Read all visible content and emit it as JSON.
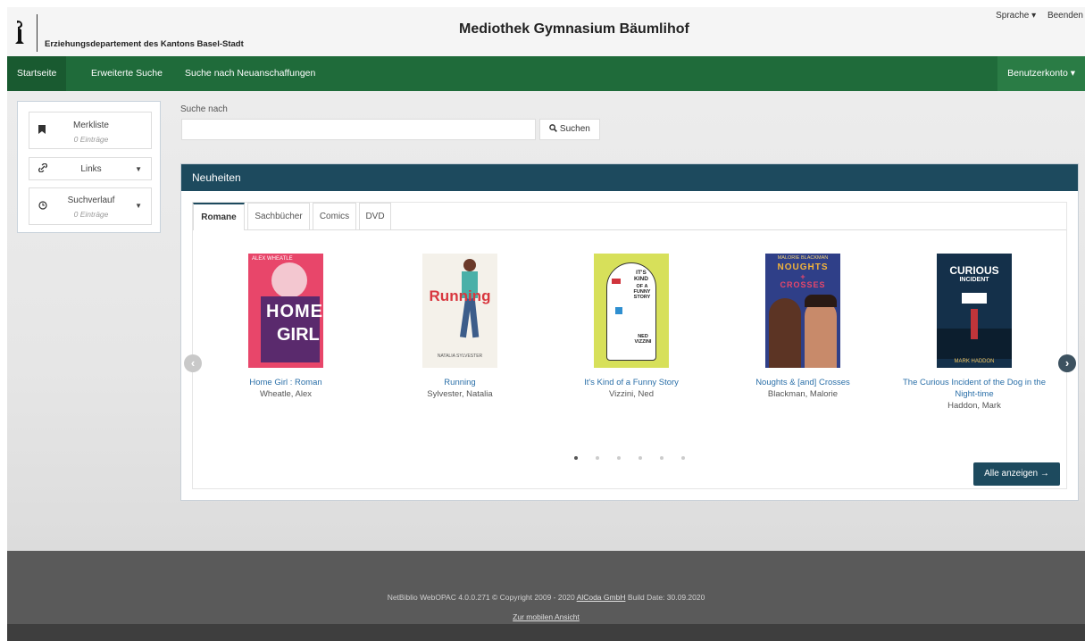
{
  "header": {
    "org_name": "Erziehungsdepartement des Kantons Basel-Stadt",
    "site_title": "Mediothek Gymnasium Bäumlihof",
    "language_link": "Sprache ▾",
    "exit_link": "Beenden"
  },
  "nav": {
    "home": "Startseite",
    "advanced_search": "Erweiterte Suche",
    "new_acquisitions": "Suche nach Neuanschaffungen",
    "account": "Benutzerkonto ▾"
  },
  "sidebar": {
    "watchlist_label": "Merkliste",
    "watchlist_count": "0 Einträge",
    "links_label": "Links",
    "history_label": "Suchverlauf",
    "history_count": "0 Einträge"
  },
  "search": {
    "label": "Suche nach",
    "value": "",
    "button": "Suchen"
  },
  "panel": {
    "title": "Neuheiten",
    "tabs": [
      "Romane",
      "Sachbücher",
      "Comics",
      "DVD"
    ],
    "books": [
      {
        "title": "Home Girl : Roman",
        "title2": "",
        "author": "Wheatle, Alex"
      },
      {
        "title": "Running",
        "title2": "",
        "author": "Sylvester, Natalia"
      },
      {
        "title": "It's Kind of a Funny Story",
        "title2": "",
        "author": "Vizzini, Ned"
      },
      {
        "title": "Noughts & [and] Crosses",
        "title2": "",
        "author": "Blackman, Malorie"
      },
      {
        "title": "The Curious Incident of the Dog in the",
        "title2": "Night-time",
        "author": "Haddon, Mark"
      }
    ],
    "covers": [
      {
        "line1": "HOME",
        "line2": "GIRL",
        "small": "ALEX WHEATLE",
        "color": "#e8466a"
      },
      {
        "line1": "Running",
        "line2": "",
        "small": "NATALIA SYLVESTER",
        "color": "#f4f1ea"
      },
      {
        "line1": "IT'S KIND",
        "line2": "OF A FUNNY STORY",
        "small": "NED VIZZINI",
        "color": "#d7e05a"
      },
      {
        "line1": "NOUGHTS",
        "line2": "CROSSES",
        "small": "MALORIE BLACKMAN",
        "color": "#2f3f88"
      },
      {
        "line1": "CURIOUS",
        "line2": "INCIDENT",
        "small": "MARK HADDON",
        "color": "#14304a"
      }
    ],
    "show_all": "Alle anzeigen →",
    "page_count": 6,
    "active_page": 1
  },
  "footer": {
    "text_before": "NetBiblio WebOPAC 4.0.0.271 © Copyright 2009 - 2020 ",
    "company_link": "AlCoda GmbH",
    "text_after": " Build Date: 30.09.2020",
    "mobile_link": "Zur mobilen Ansicht"
  },
  "colors": {
    "nav_green": "#1f6b3a",
    "panel_header": "#1d4a5e",
    "link_blue": "#2a6fa8"
  }
}
